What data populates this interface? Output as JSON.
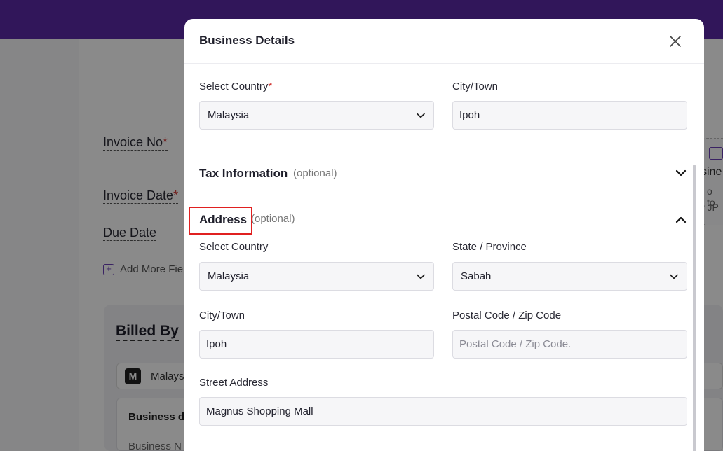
{
  "background": {
    "invoice_no_label": "Invoice No",
    "invoice_date_label": "Invoice Date",
    "due_date_label": "Due Date",
    "add_more_label": "Add More Fie",
    "billed_by_title": "Billed By",
    "billed_by_select_initial": "M",
    "billed_by_select_value": "Malays",
    "business_details_label": "Business de",
    "business_name_label": "Business N",
    "logo_text_1": "sine",
    "logo_text_2": "o to",
    "logo_text_3": "r JP",
    "required_mark": "*"
  },
  "modal": {
    "title": "Business Details",
    "country_label": "Select Country",
    "country_required": "*",
    "country_value": "Malaysia",
    "city_label": "City/Town",
    "city_value": "Ipoh",
    "tax_section": {
      "title": "Tax Information",
      "optional": "(optional)",
      "expanded": false
    },
    "address_section": {
      "title": "Address",
      "optional": "(optional)",
      "expanded": true,
      "country_label": "Select Country",
      "country_value": "Malaysia",
      "state_label": "State / Province",
      "state_value": "Sabah",
      "city_label": "City/Town",
      "city_value": "Ipoh",
      "postal_label": "Postal Code / Zip Code",
      "postal_placeholder": "Postal Code / Zip Code.",
      "street_label": "Street Address",
      "street_value": "Magnus Shopping Mall"
    }
  },
  "colors": {
    "brand": "#5b2aa6",
    "required": "#d0312d",
    "highlight": "#e02020"
  }
}
